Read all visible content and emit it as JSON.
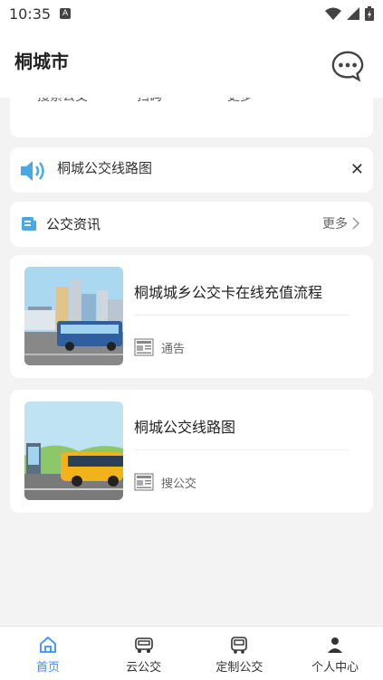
{
  "status": {
    "time": "10:35",
    "notif_icon": "A"
  },
  "header": {
    "city": "桐城市"
  },
  "partial_row": {
    "labels": [
      "搜索公交",
      "扫码",
      "更多"
    ]
  },
  "notice": {
    "text": "桐城公交线路图"
  },
  "news": {
    "title": "公交资讯",
    "more": "更多",
    "articles": [
      {
        "title": "桐城城乡公交卡在线充值流程",
        "source": "通告"
      },
      {
        "title": "桐城公交线路图",
        "source": "搜公交"
      }
    ]
  },
  "tabbar": {
    "tabs": [
      {
        "label": "首页",
        "icon": "home-icon"
      },
      {
        "label": "云公交",
        "icon": "bus-icon"
      },
      {
        "label": "定制公交",
        "icon": "custom-bus-icon"
      },
      {
        "label": "个人中心",
        "icon": "person-icon"
      }
    ],
    "active": 0
  },
  "colors": {
    "accent": "#3b8cff",
    "speaker": "#4aa8e6"
  }
}
